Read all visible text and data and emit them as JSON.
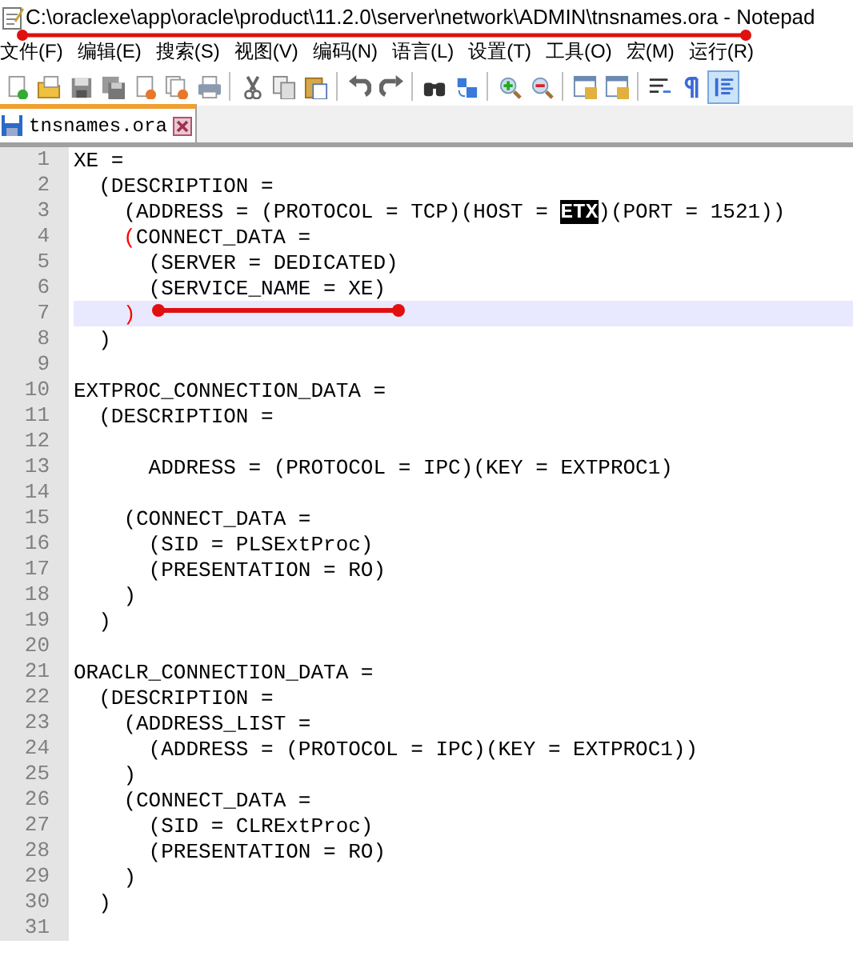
{
  "window": {
    "title": "C:\\oraclexe\\app\\oracle\\product\\11.2.0\\server\\network\\ADMIN\\tnsnames.ora - Notepad"
  },
  "menu": [
    "文件(F)",
    "编辑(E)",
    "搜索(S)",
    "视图(V)",
    "编码(N)",
    "语言(L)",
    "设置(T)",
    "工具(O)",
    "宏(M)",
    "运行(R)"
  ],
  "toolbar": [
    {
      "kind": "new",
      "pressed": false
    },
    {
      "kind": "open",
      "pressed": false
    },
    {
      "kind": "save",
      "pressed": false
    },
    {
      "kind": "save-all",
      "pressed": false
    },
    {
      "kind": "close",
      "pressed": false
    },
    {
      "kind": "close-all",
      "pressed": false
    },
    {
      "kind": "print",
      "pressed": false
    },
    {
      "kind": "sep"
    },
    {
      "kind": "cut",
      "pressed": false
    },
    {
      "kind": "copy",
      "pressed": false
    },
    {
      "kind": "paste",
      "pressed": false
    },
    {
      "kind": "sep"
    },
    {
      "kind": "undo",
      "pressed": false
    },
    {
      "kind": "redo",
      "pressed": false
    },
    {
      "kind": "sep"
    },
    {
      "kind": "find",
      "pressed": false
    },
    {
      "kind": "replace",
      "pressed": false
    },
    {
      "kind": "sep"
    },
    {
      "kind": "zoom-in",
      "pressed": false
    },
    {
      "kind": "zoom-out",
      "pressed": false
    },
    {
      "kind": "sep"
    },
    {
      "kind": "sync-v",
      "pressed": false
    },
    {
      "kind": "sync-h",
      "pressed": false
    },
    {
      "kind": "sep"
    },
    {
      "kind": "wrap",
      "pressed": false
    },
    {
      "kind": "paragraph",
      "pressed": false
    },
    {
      "kind": "indent-guide",
      "pressed": true
    }
  ],
  "tabs": [
    {
      "label": "tnsnames.ora",
      "selected": true
    }
  ],
  "editor": {
    "lines": [
      {
        "number": "1",
        "current": false,
        "text": "XE ="
      },
      {
        "number": "2",
        "current": false,
        "text": "  (DESCRIPTION ="
      },
      {
        "number": "3",
        "current": false,
        "segments": [
          {
            "text": "    (ADDRESS = (PROTOCOL = TCP)(HOST = ",
            "kind": "plain"
          },
          {
            "text": "ETX",
            "kind": "selected"
          },
          {
            "text": ")(PORT = 1521))",
            "kind": "plain"
          }
        ]
      },
      {
        "number": "4",
        "current": false,
        "kind": "nested",
        "segments": [
          {
            "text": "(",
            "kind": "brace-match"
          },
          {
            "text": "CONNECT_DATA =",
            "kind": "plain"
          }
        ]
      },
      {
        "number": "5",
        "current": false,
        "text": "      (SERVER = DEDICATED)"
      },
      {
        "number": "6",
        "current": false,
        "text": "      (SERVICE_NAME = XE)"
      },
      {
        "number": "7",
        "current": true,
        "kind": "nested",
        "segments": [
          {
            "text": ")",
            "kind": "brace-match"
          }
        ]
      },
      {
        "number": "8",
        "current": false,
        "text": "  )"
      },
      {
        "number": "9",
        "current": false
      },
      {
        "number": "10",
        "current": false,
        "text": "EXTPROC_CONNECTION_DATA ="
      },
      {
        "number": "11",
        "current": false,
        "text": "  (DESCRIPTION ="
      },
      {
        "number": "12",
        "current": false
      },
      {
        "number": "13",
        "current": false,
        "text": "      ADDRESS = (PROTOCOL = IPC)(KEY = EXTPROC1)"
      },
      {
        "number": "14",
        "current": false
      },
      {
        "number": "15",
        "current": false,
        "text": "    (CONNECT_DATA ="
      },
      {
        "number": "16",
        "current": false,
        "text": "      (SID = PLSExtProc)"
      },
      {
        "number": "17",
        "current": false,
        "text": "      (PRESENTATION = RO)"
      },
      {
        "number": "18",
        "current": false,
        "text": "    )"
      },
      {
        "number": "19",
        "current": false,
        "text": "  )"
      },
      {
        "number": "20",
        "current": false
      },
      {
        "number": "21",
        "current": false,
        "text": "ORACLR_CONNECTION_DATA ="
      },
      {
        "number": "22",
        "current": false,
        "text": "  (DESCRIPTION ="
      },
      {
        "number": "23",
        "current": false,
        "text": "    (ADDRESS_LIST ="
      },
      {
        "number": "24",
        "current": false,
        "text": "      (ADDRESS = (PROTOCOL = IPC)(KEY = EXTPROC1))"
      },
      {
        "number": "25",
        "current": false,
        "text": "    )"
      },
      {
        "number": "26",
        "current": false,
        "text": "    (CONNECT_DATA ="
      },
      {
        "number": "27",
        "current": false,
        "text": "      (SID = CLRExtProc)"
      },
      {
        "number": "28",
        "current": false,
        "text": "      (PRESENTATION = RO)"
      },
      {
        "number": "29",
        "current": false,
        "text": "    )"
      },
      {
        "number": "30",
        "current": false,
        "text": "  )"
      },
      {
        "number": "31",
        "current": false
      }
    ]
  }
}
